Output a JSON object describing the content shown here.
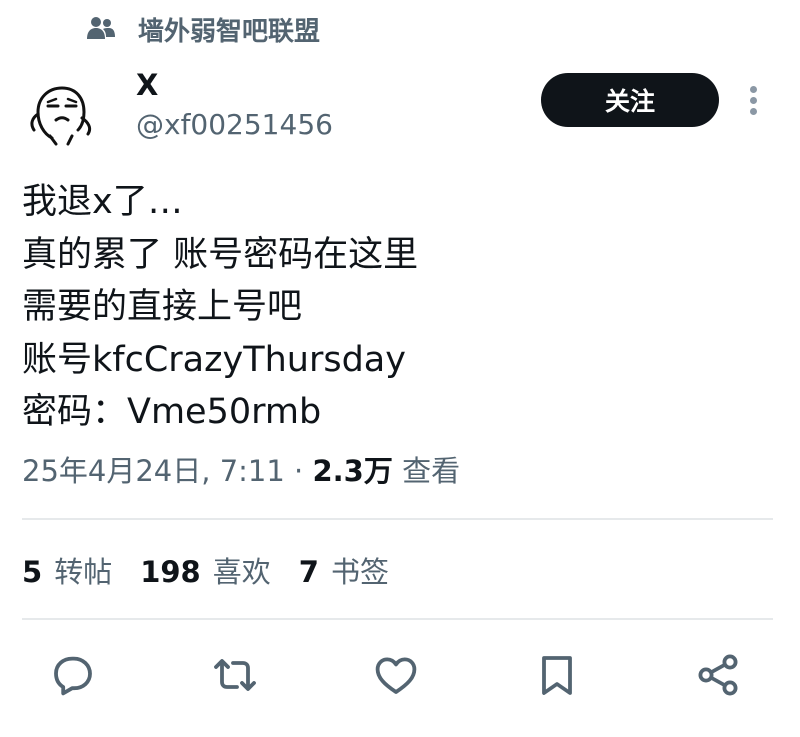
{
  "community": {
    "name": "墙外弱智吧联盟",
    "icon": "community-icon"
  },
  "author": {
    "display_name": "X",
    "handle": "@xf00251456",
    "avatar": "cartoon-face-avatar"
  },
  "follow_label": "关注",
  "tweet": {
    "lines": [
      "我退x了…",
      "真的累了 账号密码在这里",
      "需要的直接上号吧",
      "账号kfcCrazyThursday",
      "密码：Vme50rmb"
    ]
  },
  "meta": {
    "datetime": "25年4月24日, 7:11",
    "separator": "·",
    "views_count": "2.3万",
    "views_label": "查看"
  },
  "stats": {
    "reposts": {
      "count": "5",
      "label": "转帖"
    },
    "likes": {
      "count": "198",
      "label": "喜欢"
    },
    "bookmarks": {
      "count": "7",
      "label": "书签"
    }
  },
  "actions": [
    "reply-icon",
    "retweet-icon",
    "like-icon",
    "bookmark-icon",
    "share-icon"
  ],
  "colors": {
    "text": "#0f1419",
    "secondary": "#536471",
    "divider": "#e6e9eb",
    "button": "#0f1419"
  }
}
